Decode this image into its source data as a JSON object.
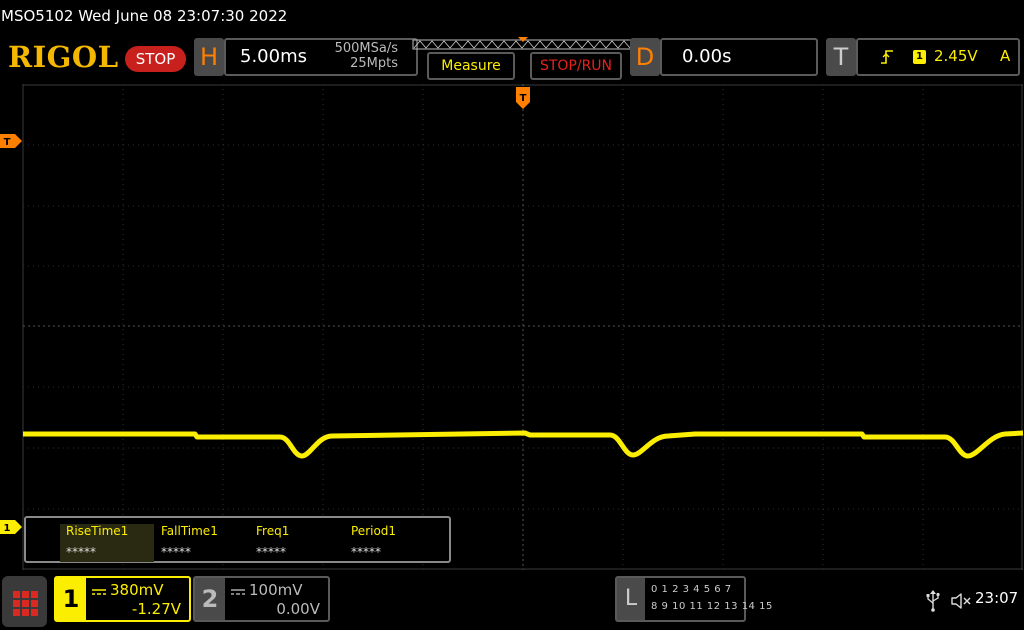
{
  "status_line": "MSO5102  Wed June 08 23:07:30 2022",
  "header": {
    "logo": "RIGOL",
    "run_state": "STOP",
    "horizontal": {
      "letter": "H",
      "timebase": "5.00ms",
      "sample_rate": "500MSa/s",
      "memory_depth": "25Mpts"
    },
    "measure_button": "Measure",
    "stop_run_button": "STOP/RUN",
    "delay": {
      "letter": "D",
      "value": "0.00s"
    },
    "trigger": {
      "letter": "T",
      "source": "1",
      "level": "2.45V",
      "mode": "A"
    }
  },
  "markers": {
    "trigger_position": "T",
    "trigger_level": "T",
    "channel1": "1"
  },
  "measurements": [
    {
      "label": "RiseTime1",
      "value": "*****"
    },
    {
      "label": "FallTime1",
      "value": "*****"
    },
    {
      "label": "Freq1",
      "value": "*****"
    },
    {
      "label": "Period1",
      "value": "*****"
    }
  ],
  "channels": [
    {
      "number": "1",
      "scale": "380mV",
      "offset": "-1.27V",
      "active": true
    },
    {
      "number": "2",
      "scale": "100mV",
      "offset": "0.00V",
      "active": false
    }
  ],
  "logic_analyzer": {
    "letter": "L",
    "row1": "0 1 2 3  4 5 6 7",
    "row2": "8 9 10 11 12 13 14 15"
  },
  "clock": "23:07",
  "colors": {
    "ch1": "#fcee00",
    "accent_orange": "#ff7f00",
    "stop_red": "#c8201c",
    "grid": "#3a3a3a",
    "logo": "#f5b800"
  },
  "icons": [
    "menu-grid-icon",
    "usb-icon",
    "speaker-mute-icon",
    "rising-edge-icon",
    "dc-coupling-icon"
  ]
}
